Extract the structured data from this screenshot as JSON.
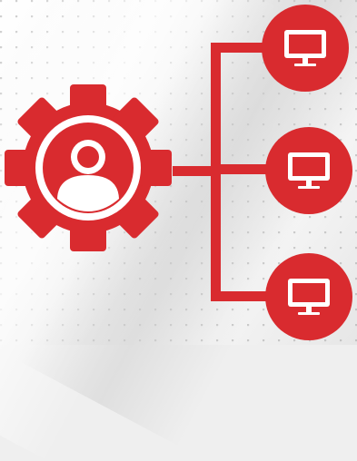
{
  "diagram": {
    "accent_color": "#d92b2f",
    "center_icon": "user-gear-icon",
    "branches": [
      {
        "icon": "monitor-icon"
      },
      {
        "icon": "monitor-icon"
      },
      {
        "icon": "monitor-icon"
      }
    ]
  }
}
